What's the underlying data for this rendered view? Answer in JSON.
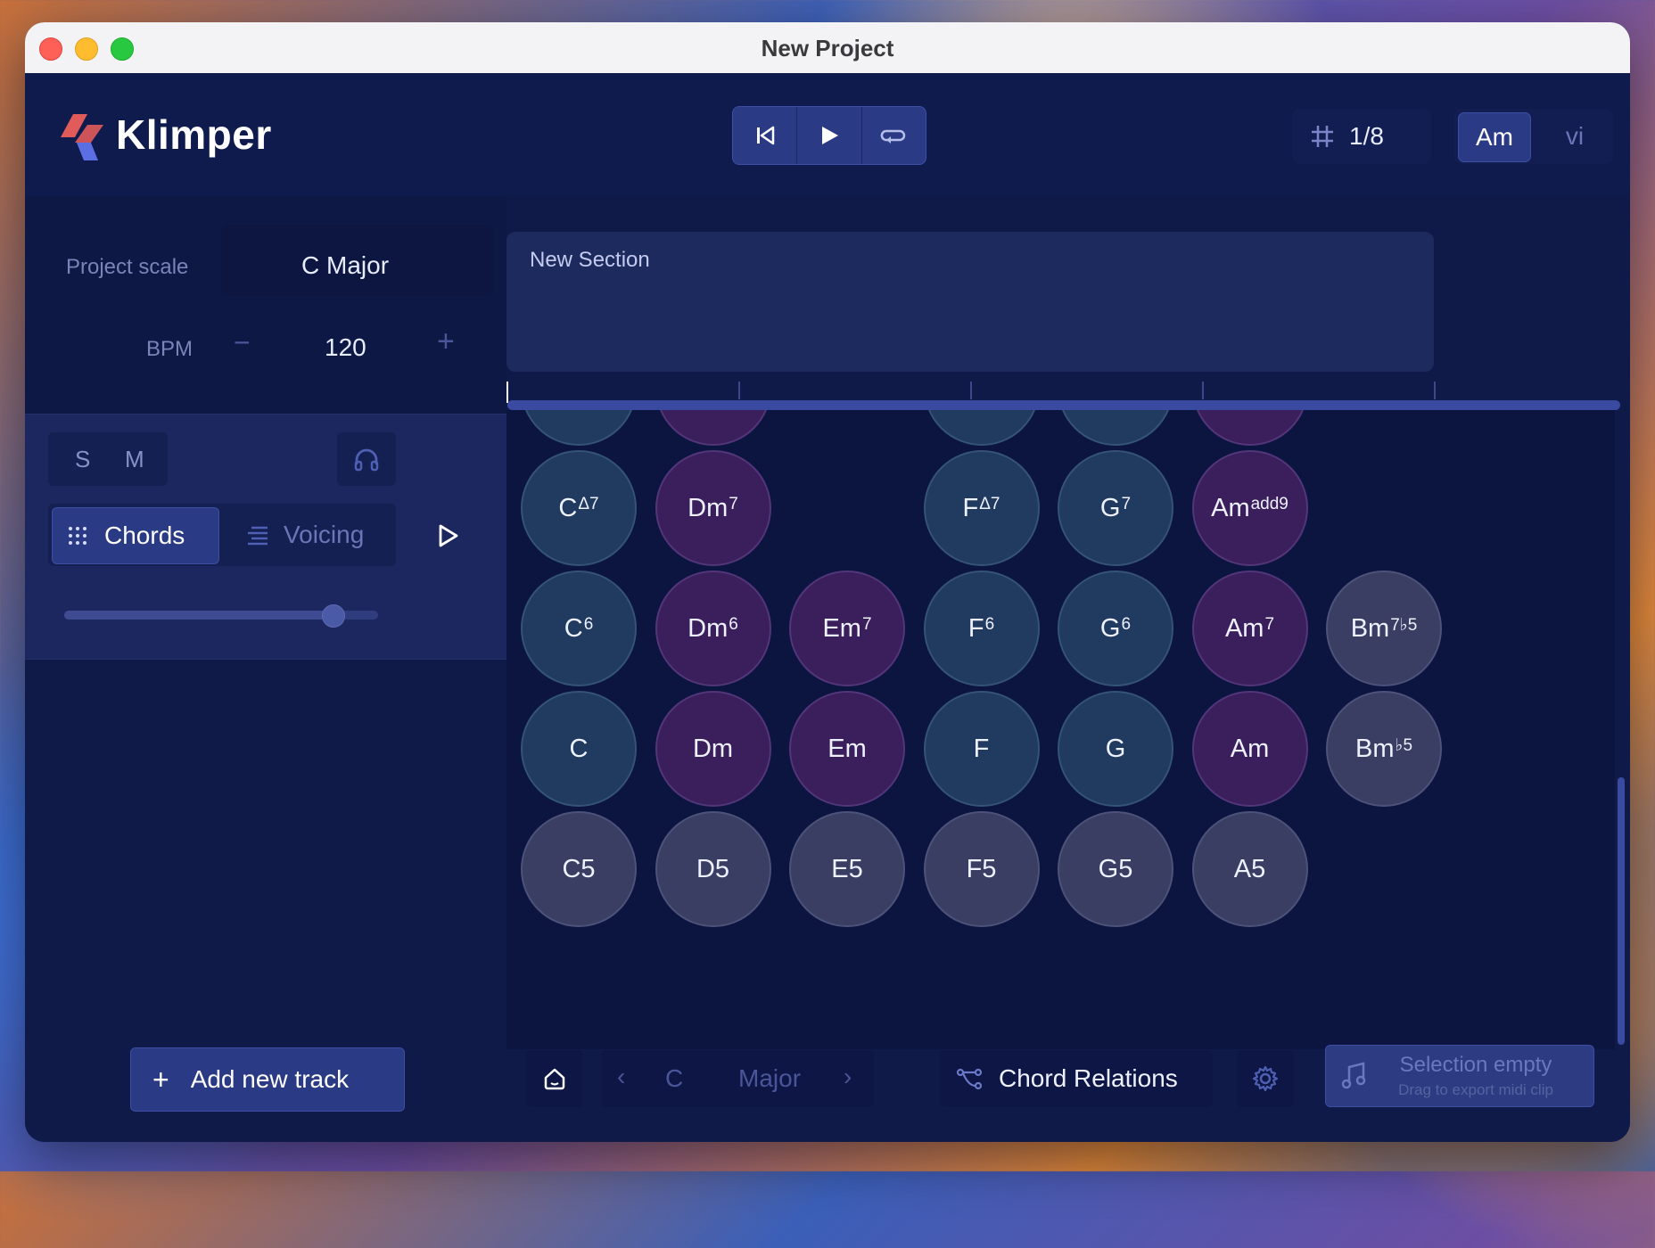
{
  "window": {
    "title": "New Project"
  },
  "app": {
    "name": "Klimper"
  },
  "transport": {
    "icons": [
      "skip-back-icon",
      "play-icon",
      "loop-icon"
    ]
  },
  "grid": {
    "value": "1/8"
  },
  "key_toggle": {
    "chord": "Am",
    "roman": "vi"
  },
  "project": {
    "scale_label": "Project scale",
    "scale_value": "C Major",
    "bpm_label": "BPM",
    "bpm_minus": "−",
    "bpm_value": "120",
    "bpm_plus": "+"
  },
  "track": {
    "solo": "S",
    "mute": "M",
    "mode_chords": "Chords",
    "mode_voicing": "Voicing",
    "volume": 0.88
  },
  "add_track": {
    "plus": "+",
    "label": "Add new track"
  },
  "section": {
    "title": "New Section"
  },
  "chord_grid": {
    "rows": [
      [
        {
          "root": "C",
          "ext": "Δ7",
          "color": "teal"
        },
        {
          "root": "Dm",
          "ext": "7",
          "color": "purple"
        },
        null,
        {
          "root": "F",
          "ext": "Δ7",
          "color": "teal"
        },
        {
          "root": "G",
          "ext": "7",
          "color": "teal"
        },
        {
          "root": "Am",
          "ext": "add9",
          "color": "purple"
        },
        null
      ],
      [
        {
          "root": "C",
          "ext": "6",
          "color": "teal"
        },
        {
          "root": "Dm",
          "ext": "6",
          "color": "purple"
        },
        {
          "root": "Em",
          "ext": "7",
          "color": "purple"
        },
        {
          "root": "F",
          "ext": "6",
          "color": "teal"
        },
        {
          "root": "G",
          "ext": "6",
          "color": "teal"
        },
        {
          "root": "Am",
          "ext": "7",
          "color": "purple"
        },
        {
          "root": "Bm",
          "ext": "7♭5",
          "color": "gray"
        }
      ],
      [
        {
          "root": "C",
          "ext": "",
          "color": "teal"
        },
        {
          "root": "Dm",
          "ext": "",
          "color": "purple"
        },
        {
          "root": "Em",
          "ext": "",
          "color": "purple"
        },
        {
          "root": "F",
          "ext": "",
          "color": "teal"
        },
        {
          "root": "G",
          "ext": "",
          "color": "teal"
        },
        {
          "root": "Am",
          "ext": "",
          "color": "purple"
        },
        {
          "root": "Bm",
          "ext": "♭5",
          "color": "gray"
        }
      ],
      [
        {
          "root": "C5",
          "ext": "",
          "color": "gray"
        },
        {
          "root": "D5",
          "ext": "",
          "color": "gray"
        },
        {
          "root": "E5",
          "ext": "",
          "color": "gray"
        },
        {
          "root": "F5",
          "ext": "",
          "color": "gray"
        },
        {
          "root": "G5",
          "ext": "",
          "color": "gray"
        },
        {
          "root": "A5",
          "ext": "",
          "color": "gray"
        },
        null
      ]
    ],
    "partial_top_row_colors": [
      "teal",
      "purple",
      null,
      "teal",
      "teal",
      "purple",
      null
    ]
  },
  "bottom_bar": {
    "key_prev": "‹",
    "key_root": "C",
    "key_mode": "Major",
    "key_next": "›",
    "relations_label": "Chord Relations",
    "export_title": "Selection empty",
    "export_subtitle": "Drag to export midi clip"
  },
  "colors": {
    "accent": "#2a3a85",
    "teal_chord": "#213a5f",
    "purple_chord": "#3a1f5c",
    "gray_chord": "#393e62",
    "logo_red": "#e25b5b",
    "logo_blue": "#5b6fe2"
  }
}
